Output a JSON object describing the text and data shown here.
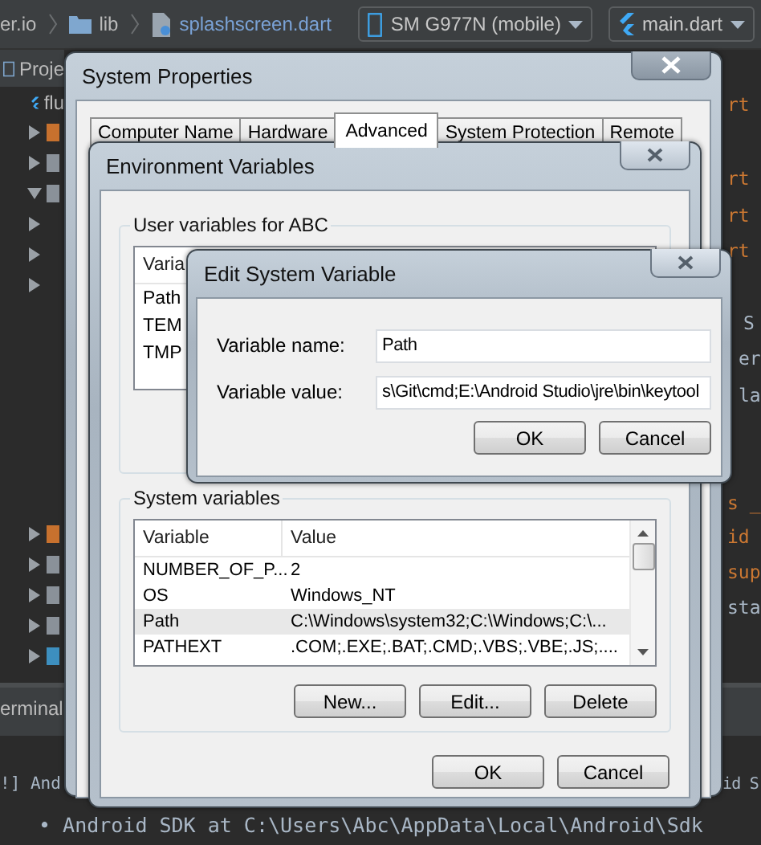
{
  "ide": {
    "breadcrumbs": [
      {
        "kind": "text",
        "label": "er.io"
      },
      {
        "kind": "folder",
        "label": "lib"
      },
      {
        "kind": "file",
        "label": "splashscreen.dart"
      }
    ],
    "device_selector": "SM G977N (mobile)",
    "run_config": "main.dart",
    "project_tab": "Proje",
    "module": "flu",
    "tree": [
      {
        "expanded": false,
        "color": "#c7712e"
      },
      {
        "expanded": false,
        "color": "#8a9199"
      },
      {
        "expanded": true,
        "color": "#8a9199"
      },
      {
        "expanded": false
      },
      {
        "expanded": false
      },
      {
        "expanded": false
      }
    ],
    "tree_lower": [
      {
        "expanded": false,
        "color": "#c7712e"
      },
      {
        "expanded": false,
        "color": "#8a9199"
      },
      {
        "expanded": false,
        "color": "#8a9199"
      },
      {
        "expanded": false,
        "color": "#8a9199"
      },
      {
        "expanded": false,
        "color": "#3d8fbf"
      }
    ],
    "code_lines": [
      {
        "text": "rt",
        "kind": "keyword"
      },
      {
        "text": "rt",
        "kind": "keyword"
      },
      {
        "text": "rt",
        "kind": "keyword"
      },
      {
        "text": "rt",
        "kind": "keyword"
      },
      {
        "text": "S",
        "kind": "plain"
      },
      {
        "text": "er",
        "kind": "plain"
      },
      {
        "text": "la",
        "kind": "plain"
      },
      {
        "text": "s _",
        "kind": "keyword"
      },
      {
        "text": "id",
        "kind": "keyword"
      },
      {
        "text": "sup",
        "kind": "keyword"
      },
      {
        "text": "sta",
        "kind": "plain"
      }
    ],
    "terminal": {
      "tab": "erminal",
      "line_left": "!] And",
      "line_right": "id S",
      "bullet_line": "• Android SDK at C:\\Users\\Abc\\AppData\\Local\\Android\\Sdk"
    }
  },
  "system_properties": {
    "title": "System Properties",
    "tabs": [
      {
        "label": "Computer Name",
        "selected": false
      },
      {
        "label": "Hardware",
        "selected": false
      },
      {
        "label": "Advanced",
        "selected": true
      },
      {
        "label": "System Protection",
        "selected": false
      },
      {
        "label": "Remote",
        "selected": false
      }
    ]
  },
  "environment_variables": {
    "title": "Environment Variables",
    "user_group": "User variables for ABC",
    "user_column": "Varia",
    "user_rows": [
      "Path",
      "TEM",
      "TMP"
    ],
    "system_group": "System variables",
    "system_columns": [
      "Variable",
      "Value"
    ],
    "system_rows": [
      {
        "name": "NUMBER_OF_P...",
        "value": "2",
        "selected": false
      },
      {
        "name": "OS",
        "value": "Windows_NT",
        "selected": false
      },
      {
        "name": "Path",
        "value": "C:\\Windows\\system32;C:\\Windows;C:\\...",
        "selected": true
      },
      {
        "name": "PATHEXT",
        "value": ".COM;.EXE;.BAT;.CMD;.VBS;.VBE;.JS;....",
        "selected": false
      }
    ],
    "list_buttons": [
      "New...",
      "Edit...",
      "Delete"
    ],
    "buttons": [
      "OK",
      "Cancel"
    ]
  },
  "edit_dialog": {
    "title": "Edit System Variable",
    "fields": [
      {
        "label": "Variable name:",
        "value": "Path"
      },
      {
        "label": "Variable value:",
        "value": "s\\Git\\cmd;E:\\Android Studio\\jre\\bin\\keytool"
      }
    ],
    "buttons": [
      "OK",
      "Cancel"
    ]
  }
}
